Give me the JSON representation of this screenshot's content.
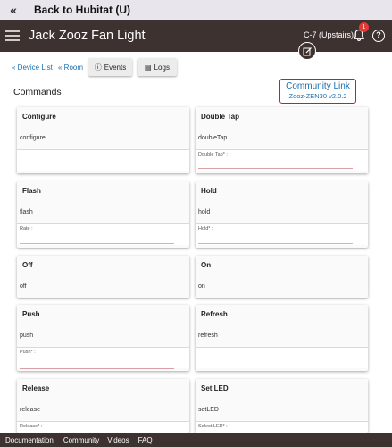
{
  "topbar": {
    "back_label": "Back to Hubitat (U)",
    "back_icon": "double-chevron-left-icon"
  },
  "header": {
    "title": "Jack Zooz Fan Light",
    "hub_name": "C-7 (Upstairs)",
    "notification_count": "1"
  },
  "nav": {
    "device_list": "« Device List",
    "room": "« Room",
    "events": "Events",
    "logs": "Logs"
  },
  "section": {
    "commands": "Commands"
  },
  "community": {
    "link": "Community Link",
    "version": "Zooz-ZEN30 v2.0.2"
  },
  "commands": [
    {
      "name": "Configure",
      "method": "configure",
      "param": ""
    },
    {
      "name": "Double Tap",
      "method": "doubleTap",
      "param": "Double Tap* :"
    },
    {
      "name": "Flash",
      "method": "flash",
      "param": "Rate :"
    },
    {
      "name": "Hold",
      "method": "hold",
      "param": "Hold* :"
    },
    {
      "name": "Off",
      "method": "off",
      "param": ""
    },
    {
      "name": "On",
      "method": "on",
      "param": ""
    },
    {
      "name": "Push",
      "method": "push",
      "param": "Push* :"
    },
    {
      "name": "Refresh",
      "method": "refresh",
      "param": ""
    },
    {
      "name": "Release",
      "method": "release",
      "param": "Release* :"
    },
    {
      "name": "Set LED",
      "method": "setLED",
      "param": "Select LED* :"
    }
  ],
  "footer": {
    "documentation": "Documentation",
    "community": "Community",
    "videos": "Videos",
    "faq": "FAQ"
  },
  "colors": {
    "header_bg": "#3d322f",
    "topbar_bg": "#e8e6ec",
    "link": "#1a6fb0",
    "accent_red": "#b3263a",
    "badge": "#e53935"
  }
}
